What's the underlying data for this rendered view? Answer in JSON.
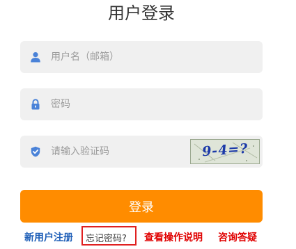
{
  "header": {
    "title": "用户登录"
  },
  "form": {
    "username": {
      "placeholder": "用户名（邮箱）",
      "value": "",
      "icon": "user-icon"
    },
    "password": {
      "placeholder": "密码",
      "value": "",
      "icon": "lock-icon"
    },
    "captcha": {
      "placeholder": "请输入验证码",
      "value": "",
      "icon": "shield-check-icon",
      "image_text": "9-4=?"
    },
    "submit_label": "登录"
  },
  "links": {
    "register": "新用户注册",
    "forgot": "忘记密码?",
    "guide": "查看操作说明",
    "consult": "咨询答疑"
  },
  "colors": {
    "accent": "#ff8c00",
    "icon": "#4a82d8",
    "link_blue": "#1f5fb8",
    "link_red": "#e00000",
    "field_bg": "#f0f0f0"
  }
}
